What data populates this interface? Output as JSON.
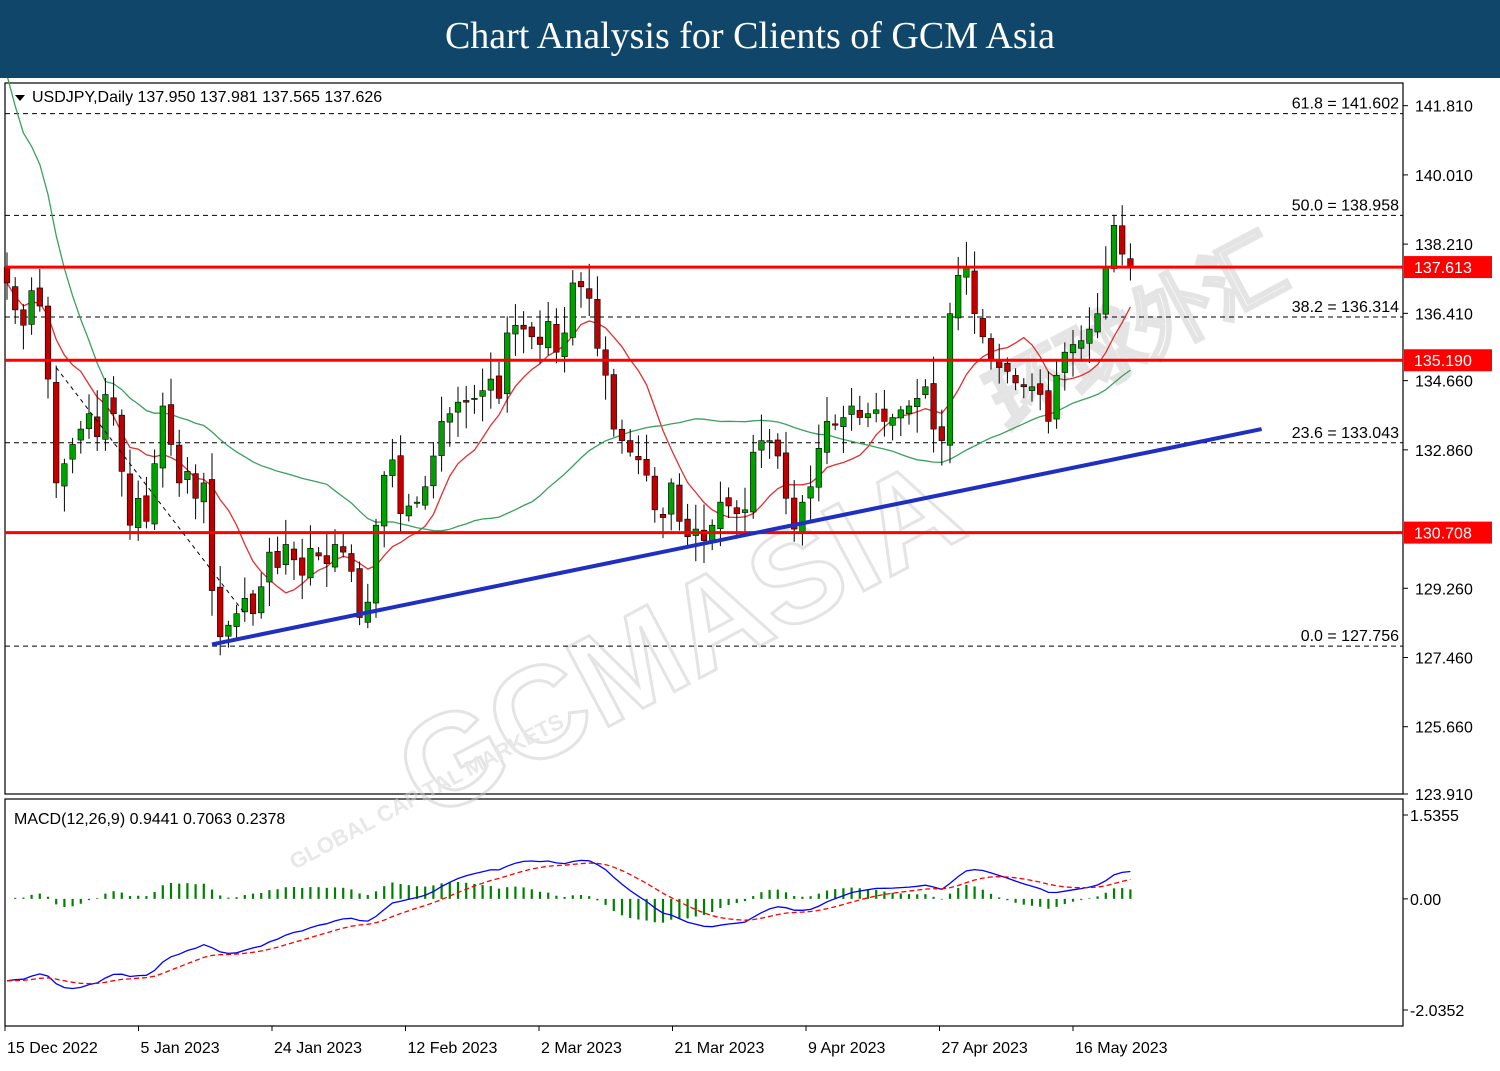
{
  "header": {
    "title": "Chart Analysis for Clients of GCM Asia"
  },
  "watermark": {
    "main": "GCMASIA",
    "sub": "GLOBAL CAPITAL MARKETS",
    "cn": "环球外汇"
  },
  "colors": {
    "banner": "#0f4669",
    "bull": "#00a000",
    "bear": "#c00000",
    "resistance": "#ff0000",
    "trendline": "#1f2fbf",
    "ma_fast": "#e03030",
    "ma_slow": "#3aa060",
    "macd_line": "#0000ff",
    "signal_line": "#ff0000",
    "histogram": "#008000"
  },
  "chart_data": [
    {
      "type": "candlestick",
      "symbol": "USDJPY,Daily",
      "ohlc_label": "USDJPY,Daily  137.950 137.981 137.565 137.626",
      "ylim": [
        123.91,
        142.4
      ],
      "y_ticks": [
        "141.810",
        "140.010",
        "138.210",
        "136.410",
        "134.660",
        "132.860",
        "129.260",
        "127.460",
        "125.660",
        "123.910"
      ],
      "x_ticks": [
        "15 Dec 2022",
        "5 Jan 2023",
        "24 Jan 2023",
        "12 Feb 2023",
        "2 Mar 2023",
        "21 Mar 2023",
        "9 Apr 2023",
        "27 Apr 2023",
        "16 May 2023"
      ],
      "horizontal_levels": [
        {
          "label": "137.613",
          "value": 137.613,
          "style": "solid"
        },
        {
          "label": "135.190",
          "value": 135.19,
          "style": "solid"
        },
        {
          "label": "130.708",
          "value": 130.708,
          "style": "solid"
        }
      ],
      "fibonacci": [
        {
          "label": "61.8 = 141.602",
          "value": 141.602
        },
        {
          "label": "50.0 = 138.958",
          "value": 138.958
        },
        {
          "label": "38.2 = 136.314",
          "value": 136.314
        },
        {
          "label": "23.6 = 133.043",
          "value": 133.043
        },
        {
          "label": "0.0 = 127.756",
          "value": 127.756
        }
      ],
      "trendline": {
        "from_bar": 1,
        "from_value": 127.8,
        "to_bar": 93,
        "to_value": 133.4
      },
      "closes": [
        137.2,
        136.5,
        136.1,
        137.0,
        136.6,
        134.7,
        132.0,
        132.5,
        133.0,
        133.4,
        133.8,
        133.2,
        134.3,
        133.8,
        132.3,
        130.9,
        131.6,
        131.0,
        132.5,
        134.0,
        133.0,
        132.0,
        132.3,
        131.6,
        132.0,
        129.2,
        128.0,
        128.3,
        128.6,
        129.0,
        128.6,
        129.3,
        130.2,
        129.8,
        130.4,
        130.0,
        129.6,
        130.3,
        130.1,
        129.9,
        130.4,
        130.2,
        129.7,
        128.5,
        128.9,
        130.9,
        132.2,
        132.6,
        131.2,
        131.4,
        131.5,
        131.9,
        132.7,
        133.6,
        133.8,
        134.1,
        134.1,
        134.2,
        134.4,
        134.7,
        134.2,
        135.9,
        136.1,
        136.0,
        135.8,
        135.6,
        136.2,
        135.4,
        135.9,
        137.2,
        137.1,
        136.8,
        135.5,
        134.8,
        133.4,
        133.1,
        132.8,
        132.6,
        132.2,
        131.3,
        131.1,
        132.0,
        131.0,
        130.6,
        130.8,
        130.5,
        130.9,
        131.5,
        131.4,
        131.2,
        131.3,
        132.8,
        133.1,
        133.1,
        132.7,
        131.6,
        130.8,
        131.5,
        131.9,
        132.9,
        133.6,
        133.5,
        133.7,
        134.0,
        133.7,
        133.8,
        133.9,
        133.6,
        133.7,
        133.9,
        134.0,
        134.2,
        134.5,
        133.4,
        133.1,
        136.4,
        137.4,
        137.6,
        136.4,
        135.8,
        135.2,
        135.0,
        134.9,
        134.6,
        134.5,
        134.5,
        134.3,
        133.6,
        134.8,
        135.4,
        135.6,
        135.7,
        136.0,
        136.4,
        137.6,
        138.7,
        137.95,
        137.63
      ]
    },
    {
      "type": "macd",
      "label": "MACD(12,26,9) 0.9441 0.7063 0.2378",
      "ylim": [
        -2.0352,
        1.5355
      ],
      "y_ticks": [
        "1.5355",
        "0.00",
        "-2.0352"
      ]
    }
  ]
}
